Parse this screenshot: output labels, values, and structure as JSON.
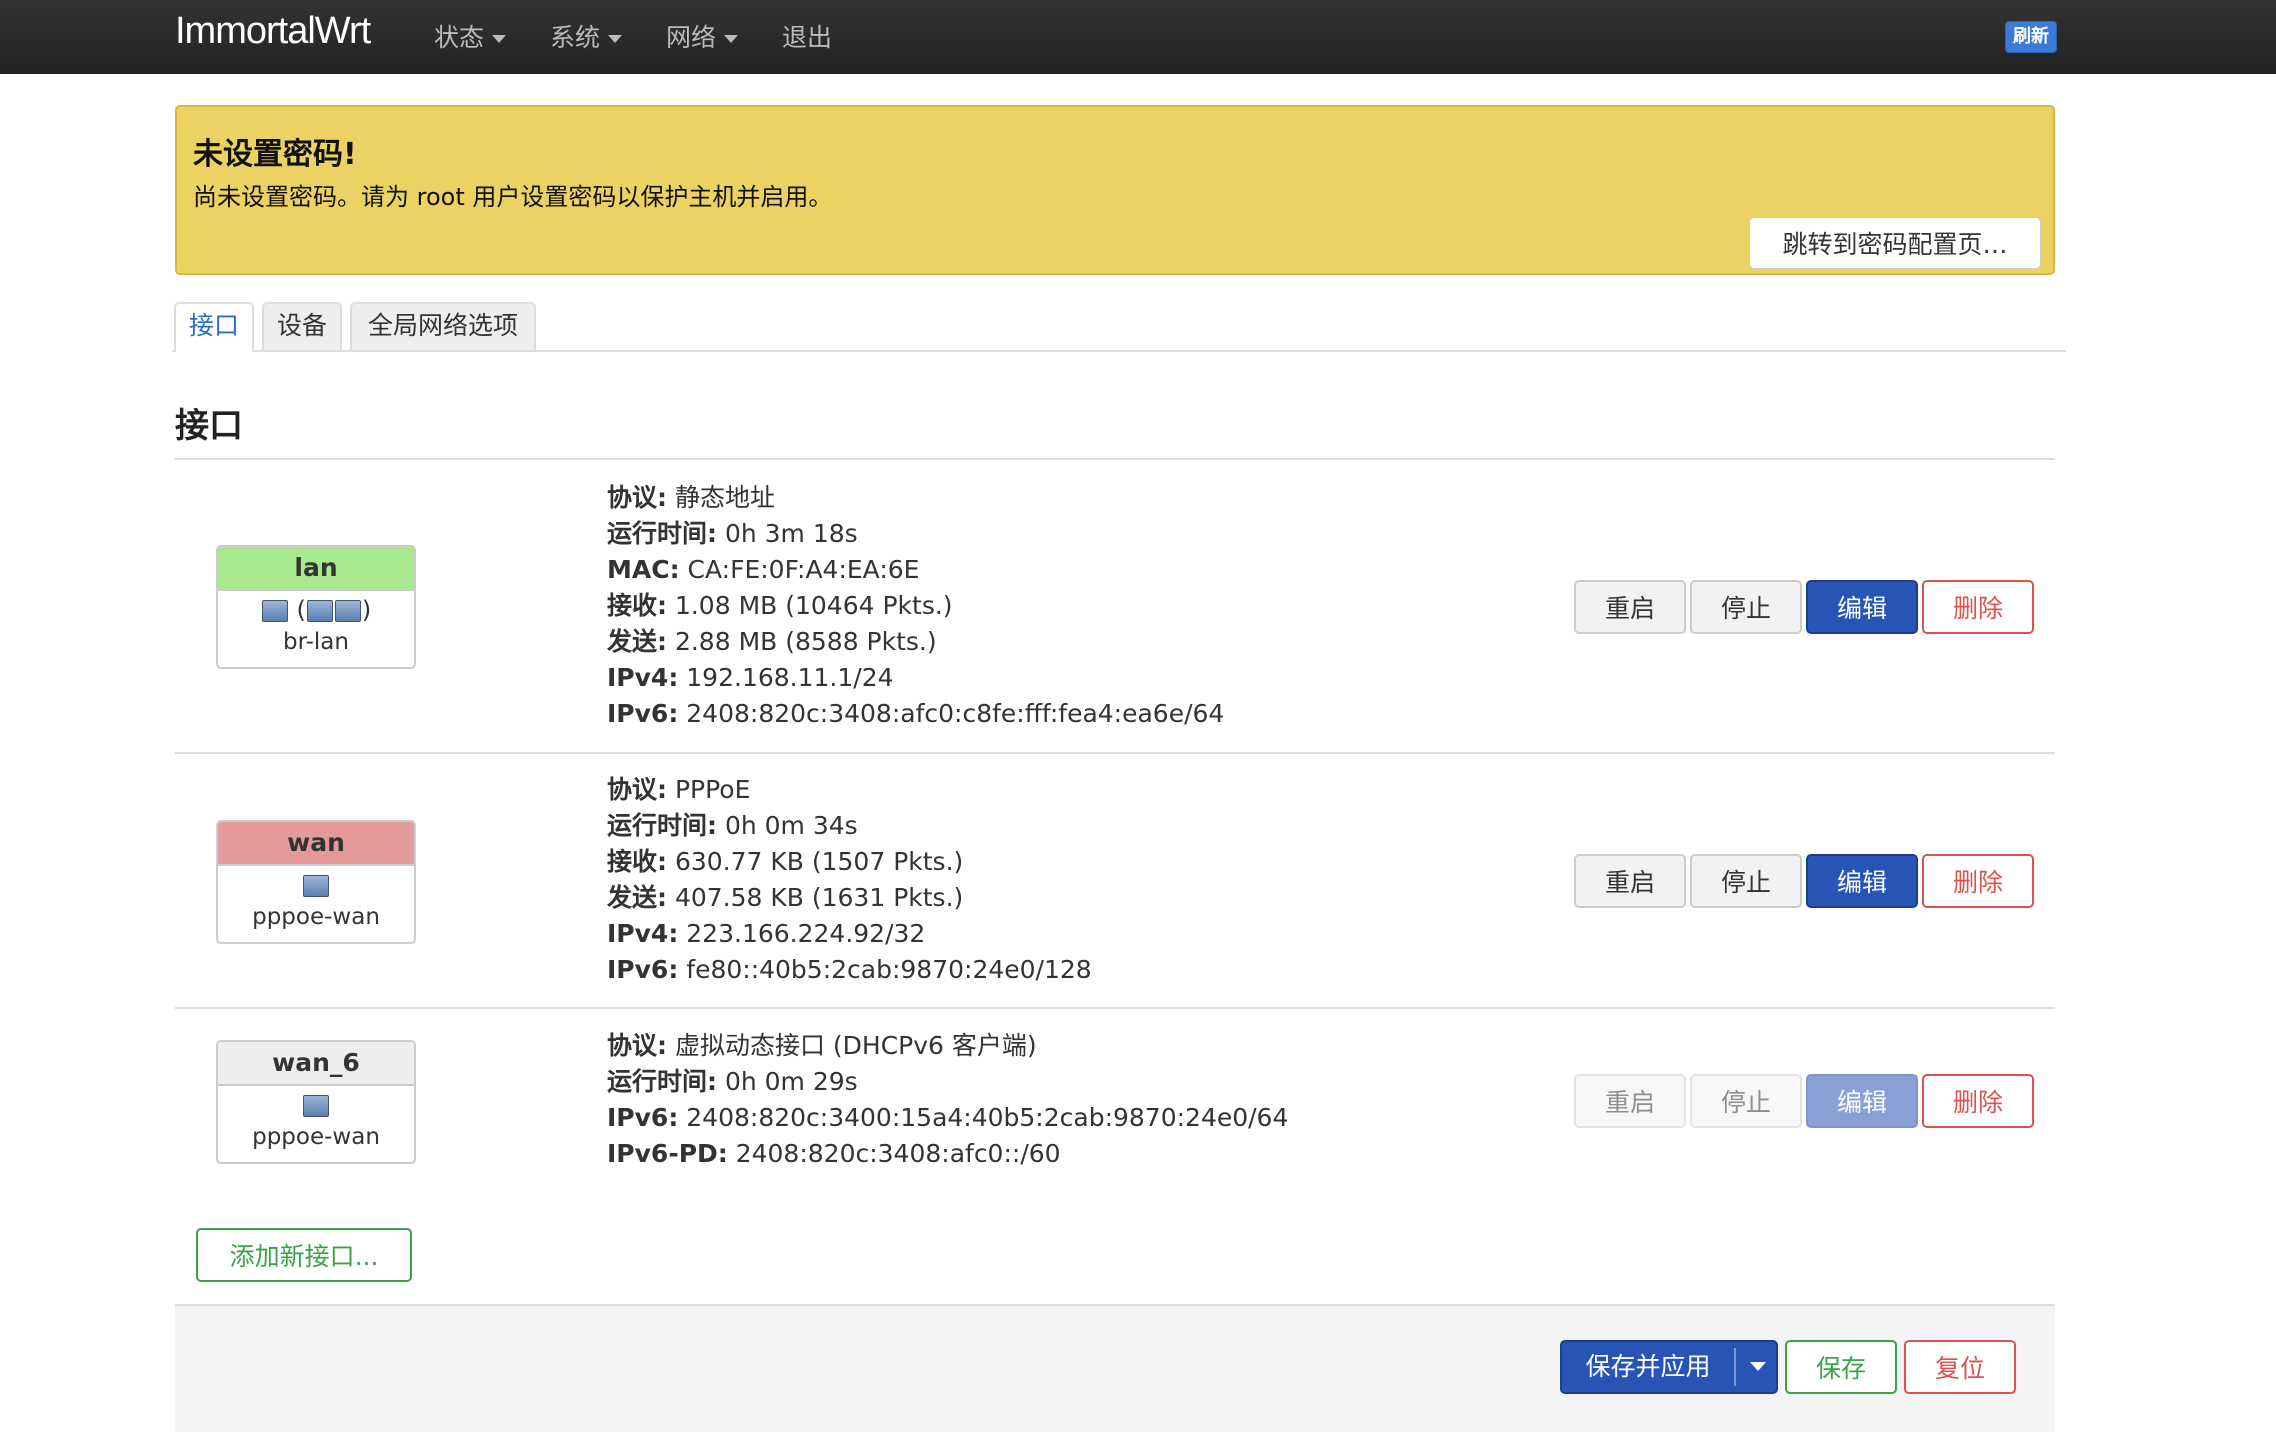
{
  "topbar": {
    "brand": "ImmortalWrt",
    "menu": [
      {
        "label": "状态",
        "has_caret": true
      },
      {
        "label": "系统",
        "has_caret": true
      },
      {
        "label": "网络",
        "has_caret": true
      },
      {
        "label": "退出",
        "has_caret": false
      }
    ],
    "refresh_label": "刷新"
  },
  "alert": {
    "title": "未设置密码!",
    "text": "尚未设置密码。请为 root 用户设置密码以保护主机并启用。",
    "button_label": "跳转到密码配置页…"
  },
  "tabs": [
    {
      "label": "接口",
      "active": true
    },
    {
      "label": "设备",
      "active": false
    },
    {
      "label": "全局网络选项",
      "active": false
    }
  ],
  "section_title": "接口",
  "interfaces": [
    {
      "name": "lan",
      "color": "#a8e88e",
      "icon": "bridge-icon",
      "device": "br-lan",
      "info": [
        {
          "label": "协议:",
          "value": "静态地址"
        },
        {
          "label": "运行时间:",
          "value": "0h 3m 18s"
        },
        {
          "label": "MAC:",
          "value": "CA:FE:0F:A4:EA:6E"
        },
        {
          "label": "接收:",
          "value": "1.08 MB (10464 Pkts.)"
        },
        {
          "label": "发送:",
          "value": "2.88 MB (8588 Pkts.)"
        },
        {
          "label": "IPv4:",
          "value": "192.168.11.1/24"
        },
        {
          "label": "IPv6:",
          "value": "2408:820c:3408:afc0:c8fe:fff:fea4:ea6e/64"
        }
      ],
      "actions_disabled": false
    },
    {
      "name": "wan",
      "color": "#e49a98",
      "icon": "network-device-icon",
      "device": "pppoe-wan",
      "info": [
        {
          "label": "协议:",
          "value": "PPPoE"
        },
        {
          "label": "运行时间:",
          "value": "0h 0m 34s"
        },
        {
          "label": "接收:",
          "value": "630.77 KB (1507 Pkts.)"
        },
        {
          "label": "发送:",
          "value": "407.58 KB (1631 Pkts.)"
        },
        {
          "label": "IPv4:",
          "value": "223.166.224.92/32"
        },
        {
          "label": "IPv6:",
          "value": "fe80::40b5:2cab:9870:24e0/128"
        }
      ],
      "actions_disabled": false
    },
    {
      "name": "wan_6",
      "color": "#eeeeee",
      "icon": "network-device-icon",
      "device": "pppoe-wan",
      "info": [
        {
          "label": "协议:",
          "value": "虚拟动态接口 (DHCPv6 客户端)"
        },
        {
          "label": "运行时间:",
          "value": "0h 0m 29s"
        },
        {
          "label": "IPv6:",
          "value": "2408:820c:3400:15a4:40b5:2cab:9870:24e0/64"
        },
        {
          "label": "IPv6-PD:",
          "value": "2408:820c:3408:afc0::/60"
        }
      ],
      "actions_disabled": true
    }
  ],
  "actions": {
    "restart": "重启",
    "stop": "停止",
    "edit": "编辑",
    "delete": "删除"
  },
  "add_interface_label": "添加新接口...",
  "footer": {
    "save_apply": "保存并应用",
    "save": "保存",
    "reset": "复位"
  }
}
